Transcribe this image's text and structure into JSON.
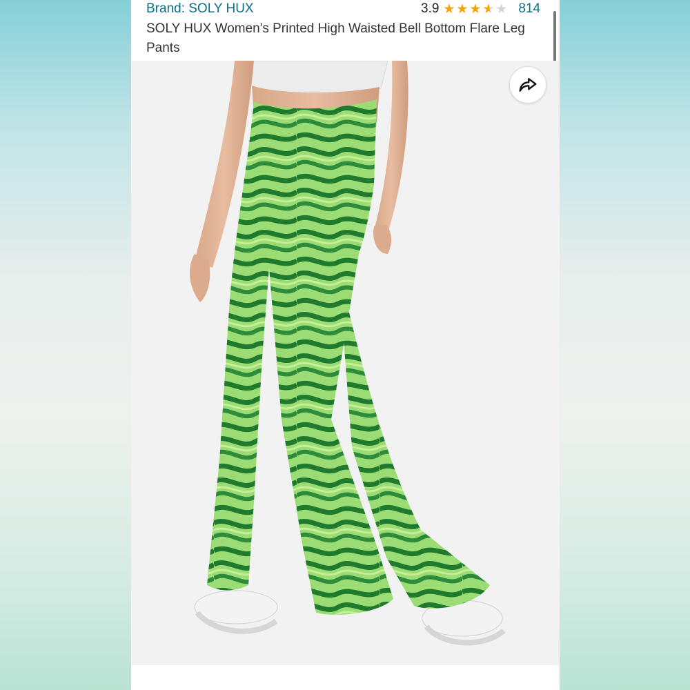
{
  "product": {
    "brand": "Brand: SOLY HUX",
    "rating": "3.9",
    "rating_value": 3.9,
    "review_count": "814",
    "title": "SOLY HUX Women's Printed High Waisted Bell Bottom Flare Leg Pants"
  },
  "colors": {
    "link": "#0a6f84",
    "star": "#f0a500",
    "pants_dark": "#1f7a2e",
    "pants_light": "#8fd66a"
  },
  "icons": {
    "share": "share-icon"
  }
}
